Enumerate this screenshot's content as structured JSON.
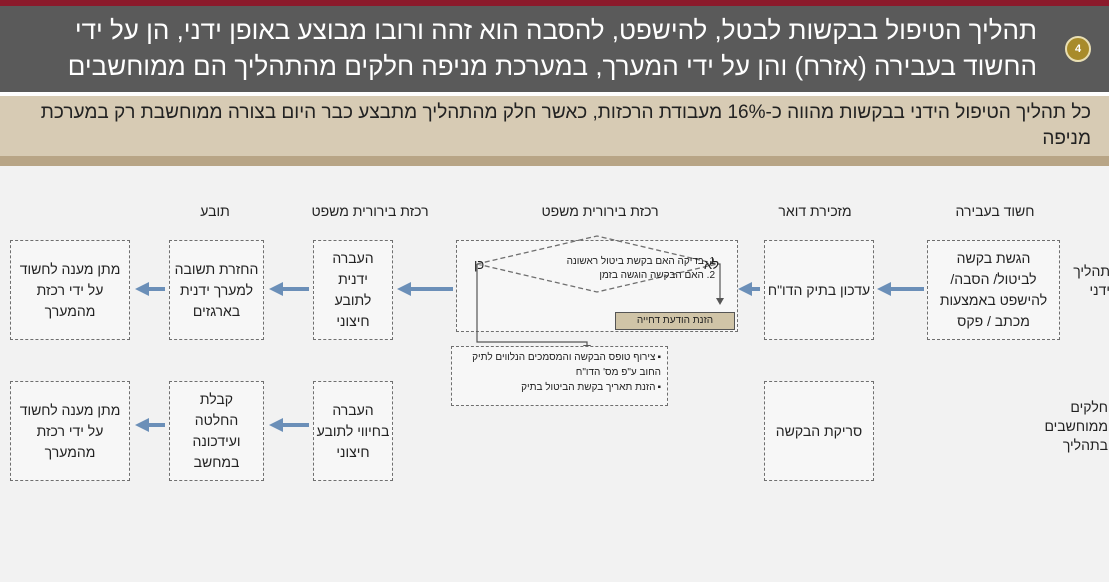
{
  "header": {
    "number": "4",
    "title": "תהליך הטיפול בבקשות לבטל, להישפט, להסבה הוא זהה ורובו מבוצע באופן ידני, הן על ידי החשוד בעבירה (אזרח) והן על ידי המערך, במערכת מניפה חלקים מהתהליך הם ממוחשבים"
  },
  "subtitle": "כל תהליך הטיפול הידני בבקשות מהווה כ-16% מעבודת הרכזות, כאשר חלק מהתהליך מתבצע כבר היום בצורה ממוחשבת רק במערכת מניפה",
  "colors": {
    "accent": "#8b1a2b",
    "header_bg": "#5a5a5a",
    "sub_bg": "#d7cbb4",
    "arrow": "#6b8fb8",
    "badge": "#a88b2a"
  },
  "columns": [
    "חשוד בעבירה",
    "מזכירת דואר",
    "רכזת בירורית משפט",
    "רכזת בירורית משפט",
    "תובע"
  ],
  "rows": {
    "manual_label": "תהליך ידני",
    "computerized_label": "חלקים ממוחשבים בתהליך"
  },
  "manual": {
    "submit": "הגשת בקשה לביטול/ הסבה/ להישפט באמצעות מכתב / פקס",
    "update": "עדכון בתיק הדו\"ח",
    "decision_no": "לא",
    "decision_yes": "כן",
    "check1": "1. בדיקה האם בקשת ביטול ראשונה",
    "check2": "2. האם הבקשה הוגשה בזמן",
    "notify": "הזנת הודעת דחייה",
    "transfer": "העברה ידנית לתובע חיצוני",
    "return": "החזרת תשובה למערך ידנית בארגזים",
    "answer": "מתן מענה לחשוד על ידי רכזת מהמערך"
  },
  "bullets": [
    "צירוף טופס הבקשה והמסמכים הנלווים לתיק החוב ע\"פ מס' הדו\"ח",
    "הזנת תאריך בקשת הביטול בתיק"
  ],
  "computerized": {
    "scan": "סריקת הבקשה",
    "transfer": "העברה בחיווי לתובע חיצוני",
    "receive": "קבלת החלטה ועידכונה במחשב",
    "answer": "מתן מענה לחשוד על ידי רכזת מהמערך"
  }
}
